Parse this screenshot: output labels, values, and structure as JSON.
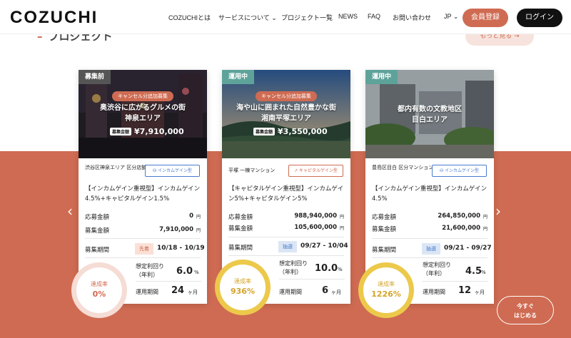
{
  "header": {
    "logo": "COZUCHI",
    "nav": [
      "COZUCHIとは",
      "サービスについて",
      "プロジェクト一覧",
      "NEWS",
      "FAQ",
      "お問い合わせ"
    ],
    "lang": "JP",
    "register_label": "会員登録",
    "login_label": "ログイン"
  },
  "section": {
    "title": "プロジェクト",
    "more_label": "もっと見る →"
  },
  "cards": [
    {
      "status": "募集前",
      "status_color": "#555555",
      "pill": "キャンセル分追加募集",
      "title_line1": "奥渋谷に広がるグルメの街",
      "title_line2": "神泉エリア",
      "amount_tag": "募集金額",
      "amount": "¥7,910,000",
      "location": "渋谷区神泉エリア 区分店舗",
      "type": "インカムゲイン型",
      "name": "【インカムゲイン重視型】インカムゲイン4.5%+キャピタルゲイン1.5%",
      "applied_label": "応募金額",
      "applied_value": "0",
      "target_label": "募集金額",
      "target_value": "7,910,000",
      "unit_yen": "円",
      "period_label": "募集期間",
      "period_badge": "先着",
      "period_value": "10/18 - 10/19",
      "rate_label": "達成率",
      "rate_value": "0%",
      "yield_label_1": "想定利回り",
      "yield_label_2": "（年利）",
      "yield_value": "6.0",
      "yield_unit": "%",
      "term_label": "運用期間",
      "term_value": "24",
      "term_unit": "ヶ月"
    },
    {
      "status": "運用中",
      "status_color": "#5ea39a",
      "pill": "キャンセル分追加募集",
      "title_line1": "海や山に囲まれた自然豊かな街",
      "title_line2": "湘南平塚エリア",
      "amount_tag": "募集金額",
      "amount": "¥3,550,000",
      "location": "平塚 一棟マンション",
      "type": "キャピタルゲイン型",
      "name": "【キャピタルゲイン重視型】インカムゲイン5%+キャピタルゲイン5%",
      "applied_label": "応募金額",
      "applied_value": "988,940,000",
      "target_label": "募集金額",
      "target_value": "105,600,000",
      "unit_yen": "円",
      "period_label": "募集期間",
      "period_badge": "抽選",
      "period_value": "09/27 - 10/04",
      "rate_label": "達成率",
      "rate_value": "936%",
      "yield_label_1": "想定利回り",
      "yield_label_2": "（年利）",
      "yield_value": "10.0",
      "yield_unit": "%",
      "term_label": "運用期間",
      "term_value": "6",
      "term_unit": "ヶ月"
    },
    {
      "status": "運用中",
      "status_color": "#5ea39a",
      "title_line1": "都内有数の文教地区",
      "title_line2": "目白エリア",
      "location": "豊島区目白 区分マンション",
      "type": "インカムゲイン型",
      "name": "【インカムゲイン重視型】インカムゲイン4.5%",
      "applied_label": "応募金額",
      "applied_value": "264,850,000",
      "target_label": "募集金額",
      "target_value": "21,600,000",
      "unit_yen": "円",
      "period_label": "募集期間",
      "period_badge": "抽選",
      "period_value": "09/21 - 09/27",
      "rate_label": "達成率",
      "rate_value": "1226%",
      "yield_label_1": "想定利回り",
      "yield_label_2": "（年利）",
      "yield_value": "4.5",
      "yield_unit": "%",
      "term_label": "運用期間",
      "term_value": "12",
      "term_unit": "ヶ月"
    }
  ],
  "carousel": {
    "prev_icon": "chevron-left-icon",
    "next_icon": "chevron-right-icon"
  },
  "cta": {
    "line1": "今すぐ",
    "line2": "はじめる"
  },
  "colors": {
    "accent": "#cf6b52",
    "dark": "#111111",
    "gold": "#ecc94b",
    "teal": "#5ea39a",
    "blue": "#4a7bd0"
  }
}
